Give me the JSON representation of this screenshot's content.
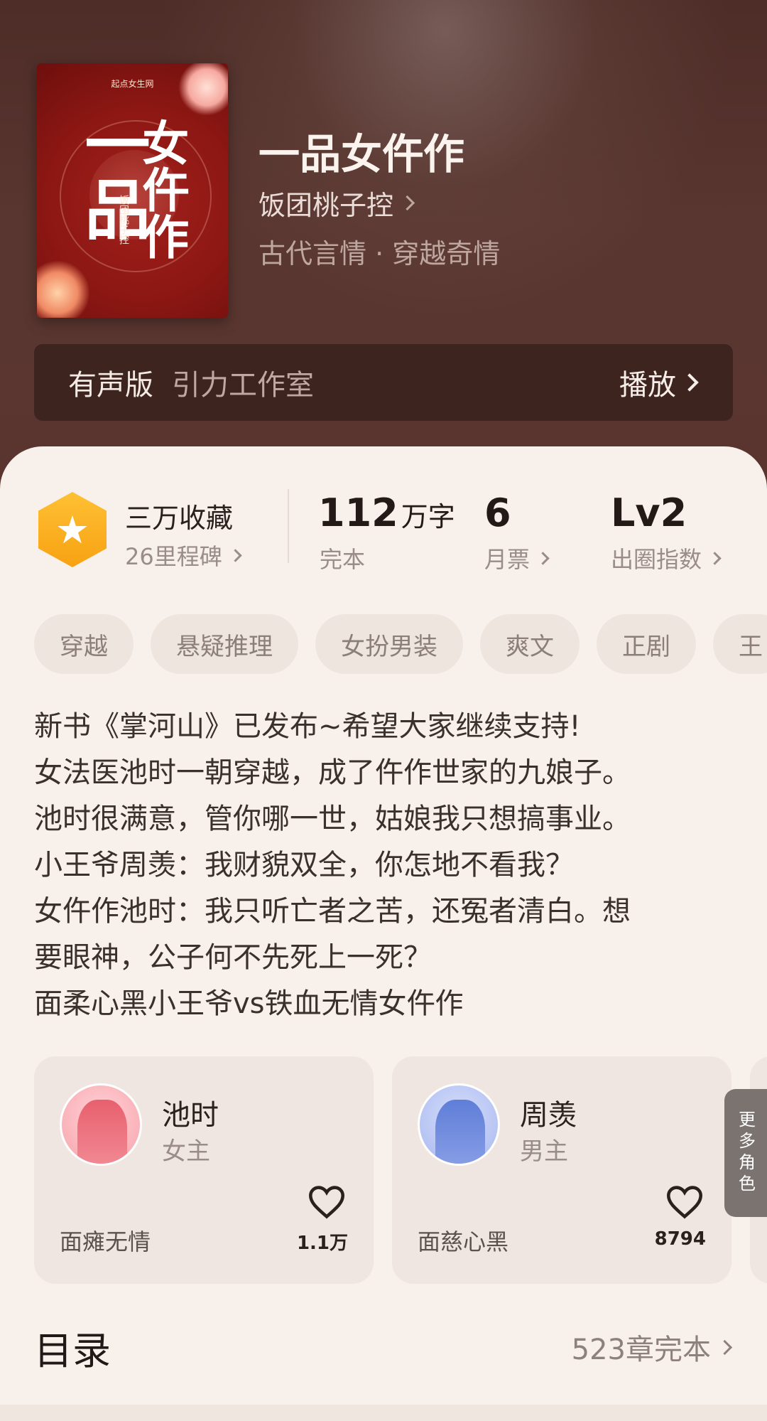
{
  "book": {
    "title": "一品女仵作",
    "author": "饭团桃子控",
    "genre": "古代言情 · 穿越奇情",
    "cover": {
      "publisher_logo": "起点女生网",
      "title_line1": "一品",
      "title_line2": "女仵作",
      "author_vertical": "饭团桃子控"
    }
  },
  "audio": {
    "label": "有声版",
    "studio": "引力工作室",
    "play_label": "播放"
  },
  "stats": {
    "favorites": "三万收藏",
    "milestones": "26里程碑",
    "words_num": "112",
    "words_unit": "万字",
    "words_label": "完本",
    "monthly_votes": "6",
    "monthly_votes_label": "月票",
    "influence": "Lv2",
    "influence_label": "出圈指数"
  },
  "tags": [
    "穿越",
    "悬疑推理",
    "女扮男装",
    "爽文",
    "正剧",
    "王"
  ],
  "description": [
    "新书《掌河山》已发布~希望大家继续支持!",
    "女法医池时一朝穿越，成了仵作世家的九娘子。",
    "池时很满意，管你哪一世，姑娘我只想搞事业。",
    "小王爷周羡：我财貌双全，你怎地不看我？",
    "女仵作池时：我只听亡者之苦，还冤者清白。想",
    "要眼神，公子何不先死上一死？",
    "面柔心黑小王爷vs铁血无情女仵作"
  ],
  "roles": [
    {
      "name": "池时",
      "type": "女主",
      "desc": "面瘫无情",
      "likes": "1.1万",
      "color": "#f07f8a"
    },
    {
      "name": "周羡",
      "type": "男主",
      "desc": "面慈心黑",
      "likes": "8794",
      "color": "#7f96dd"
    }
  ],
  "more_roles": "更多角色",
  "toc": {
    "title": "目录",
    "summary": "523章完本"
  },
  "colors": {
    "hero_bg": "#56322c",
    "card_bg": "#f8f0eb",
    "badge": "#f7a212"
  }
}
